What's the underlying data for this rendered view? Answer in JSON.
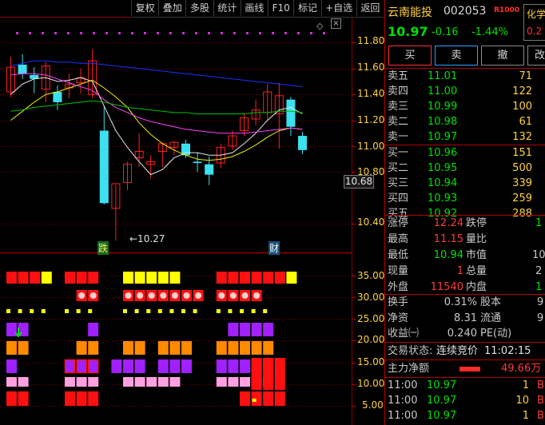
{
  "toolbar": {
    "buttons": [
      "复权",
      "叠加",
      "多股",
      "统计",
      "画线",
      "F10",
      "标记",
      "+自选",
      "返回"
    ]
  },
  "chart": {
    "price_axis_labels": [
      "11.80",
      "11.60",
      "11.40",
      "11.20",
      "11.00",
      "10.80",
      "10.40"
    ],
    "current_price_tag": "10.68",
    "low_annotation": "←10.27",
    "marker_fall": "跌",
    "marker_cai": "财",
    "indicator_axis_labels": [
      "35.00",
      "30.00",
      "25.00",
      "20.00",
      "15.00",
      "10.00",
      "5.00"
    ],
    "colors": {
      "up": "#ff2020",
      "down": "#3ce0f0",
      "ma5": "#e8e8e8",
      "ma10": "#f0f000",
      "ma20": "#ff40ff",
      "ma60": "#00c000",
      "ma120": "#2030ff",
      "grid": "#8b0000"
    },
    "candles": [
      {
        "o": 11.42,
        "h": 11.69,
        "l": 11.38,
        "c": 11.61
      },
      {
        "o": 11.63,
        "h": 11.71,
        "l": 11.52,
        "c": 11.56
      },
      {
        "o": 11.55,
        "h": 11.61,
        "l": 11.41,
        "c": 11.52
      },
      {
        "o": 11.44,
        "h": 11.65,
        "l": 11.34,
        "c": 11.62
      },
      {
        "o": 11.42,
        "h": 11.47,
        "l": 11.28,
        "c": 11.34
      },
      {
        "o": 11.45,
        "h": 11.56,
        "l": 11.37,
        "c": 11.48
      },
      {
        "o": 11.49,
        "h": 11.6,
        "l": 11.41,
        "c": 11.53
      },
      {
        "o": 11.4,
        "h": 11.75,
        "l": 11.37,
        "c": 11.66
      },
      {
        "o": 11.12,
        "h": 11.31,
        "l": 10.55,
        "c": 10.56
      },
      {
        "o": 10.52,
        "h": 10.7,
        "l": 10.27,
        "c": 10.71
      },
      {
        "o": 10.72,
        "h": 10.88,
        "l": 10.66,
        "c": 10.86
      },
      {
        "o": 10.91,
        "h": 11.1,
        "l": 10.84,
        "c": 10.96
      },
      {
        "o": 10.86,
        "h": 10.93,
        "l": 10.75,
        "c": 10.88
      },
      {
        "o": 10.96,
        "h": 11.03,
        "l": 10.84,
        "c": 11.02
      },
      {
        "o": 10.99,
        "h": 11.04,
        "l": 10.93,
        "c": 11.03
      },
      {
        "o": 11.02,
        "h": 11.05,
        "l": 10.91,
        "c": 10.93
      },
      {
        "o": 10.88,
        "h": 10.95,
        "l": 10.8,
        "c": 10.87
      },
      {
        "o": 10.86,
        "h": 10.92,
        "l": 10.7,
        "c": 10.78
      },
      {
        "o": 10.87,
        "h": 11.02,
        "l": 10.83,
        "c": 10.99
      },
      {
        "o": 11.0,
        "h": 11.12,
        "l": 10.97,
        "c": 11.08
      },
      {
        "o": 11.12,
        "h": 11.25,
        "l": 11.08,
        "c": 11.22
      },
      {
        "o": 11.21,
        "h": 11.36,
        "l": 11.16,
        "c": 11.28
      },
      {
        "o": 11.26,
        "h": 11.48,
        "l": 11.2,
        "c": 11.42
      },
      {
        "o": 11.25,
        "h": 11.49,
        "l": 10.98,
        "c": 11.39
      },
      {
        "o": 11.36,
        "h": 11.38,
        "l": 11.08,
        "c": 11.15
      },
      {
        "o": 11.08,
        "h": 11.11,
        "l": 10.94,
        "c": 10.97
      }
    ],
    "ma5": [
      11.4,
      11.48,
      11.52,
      11.53,
      11.5,
      11.51,
      11.53,
      11.5,
      11.31,
      11.12,
      10.99,
      10.88,
      10.78,
      10.82,
      10.91,
      10.95,
      10.95,
      10.93,
      10.93,
      10.95,
      11.02,
      11.1,
      11.2,
      11.28,
      11.3,
      11.25
    ],
    "ma10": [
      11.2,
      11.27,
      11.34,
      11.4,
      11.42,
      11.45,
      11.48,
      11.51,
      11.45,
      11.38,
      11.3,
      11.18,
      11.09,
      11.02,
      10.97,
      10.93,
      10.9,
      10.89,
      10.9,
      10.92,
      10.96,
      11.01,
      11.07,
      11.12,
      11.14,
      11.13
    ],
    "ma20": [
      11.55,
      11.56,
      11.56,
      11.55,
      11.52,
      11.49,
      11.46,
      11.43,
      11.36,
      11.3,
      11.26,
      11.22,
      11.19,
      11.17,
      11.15,
      11.13,
      11.12,
      11.11,
      11.1,
      11.1,
      11.1,
      11.11,
      11.12,
      11.13,
      11.14,
      11.13
    ],
    "ma60": [
      11.27,
      11.28,
      11.3,
      11.31,
      11.32,
      11.33,
      11.34,
      11.35,
      11.34,
      11.32,
      11.3,
      11.29,
      11.28,
      11.27,
      11.26,
      11.26,
      11.25,
      11.25,
      11.25,
      11.25,
      11.25,
      11.26,
      11.26,
      11.27,
      11.27,
      11.26
    ],
    "ma120": [
      11.62,
      11.64,
      11.66,
      11.66,
      11.65,
      11.65,
      11.64,
      11.64,
      11.63,
      11.62,
      11.61,
      11.6,
      11.59,
      11.58,
      11.57,
      11.56,
      11.55,
      11.54,
      11.53,
      11.52,
      11.51,
      11.5,
      11.49,
      11.48,
      11.47,
      11.46
    ]
  },
  "quote": {
    "stock_name": "云南能投",
    "stock_code": "002053",
    "badge": "R1000",
    "indicator_label": "化学",
    "indicator_value": "0.2",
    "last_price": "10.97",
    "change": "-0.16",
    "change_pct": "-1.44%",
    "buy_label": "买",
    "sell_label": "卖",
    "cancel_label": "撤",
    "edit_label": "改",
    "asks": [
      {
        "label": "卖五",
        "price": "11.01",
        "vol": "71"
      },
      {
        "label": "卖四",
        "price": "11.00",
        "vol": "122"
      },
      {
        "label": "卖三",
        "price": "10.99",
        "vol": "100"
      },
      {
        "label": "卖二",
        "price": "10.98",
        "vol": "61"
      },
      {
        "label": "卖一",
        "price": "10.97",
        "vol": "132"
      }
    ],
    "bids": [
      {
        "label": "买一",
        "price": "10.96",
        "vol": "151"
      },
      {
        "label": "买二",
        "price": "10.95",
        "vol": "500"
      },
      {
        "label": "买三",
        "price": "10.94",
        "vol": "339"
      },
      {
        "label": "买四",
        "price": "10.93",
        "vol": "259"
      },
      {
        "label": "买五",
        "price": "10.92",
        "vol": "288"
      }
    ],
    "stats": [
      {
        "label": "涨停",
        "value": "12.24",
        "label2": "跌停",
        "value2": "1"
      },
      {
        "label": "最高",
        "value": "11.15",
        "label2": "量比",
        "value2": ""
      },
      {
        "label": "最低",
        "value": "10.94",
        "label2": "市值",
        "value2": "10"
      },
      {
        "label": "现量",
        "value": "1",
        "label2": "总量",
        "value2": "2"
      },
      {
        "label": "外盘",
        "value": "11540",
        "label2": "内盘",
        "value2": "1"
      }
    ],
    "finance": [
      {
        "label": "换手",
        "value": "0.31%",
        "label2": "股本",
        "value2": "9"
      },
      {
        "label": "净资",
        "value": "8.31",
        "label2": "流通",
        "value2": "9"
      },
      {
        "label": "收益㈠",
        "value": "0.240",
        "label2": "PE(动)",
        "value2": ""
      }
    ],
    "trade_status_label": "交易状态:",
    "trade_status": "连续竞价",
    "trade_time": "11:02:15",
    "net_inflow_label": "主力净额",
    "net_inflow_value": "49.66万",
    "ticks": [
      {
        "time": "11:00",
        "price": "10.97",
        "vol": "1",
        "side": "B"
      },
      {
        "time": "11:00",
        "price": "10.97",
        "vol": "10",
        "side": "B"
      },
      {
        "time": "11:00",
        "price": "10.97",
        "vol": "1",
        "side": "B"
      }
    ]
  }
}
